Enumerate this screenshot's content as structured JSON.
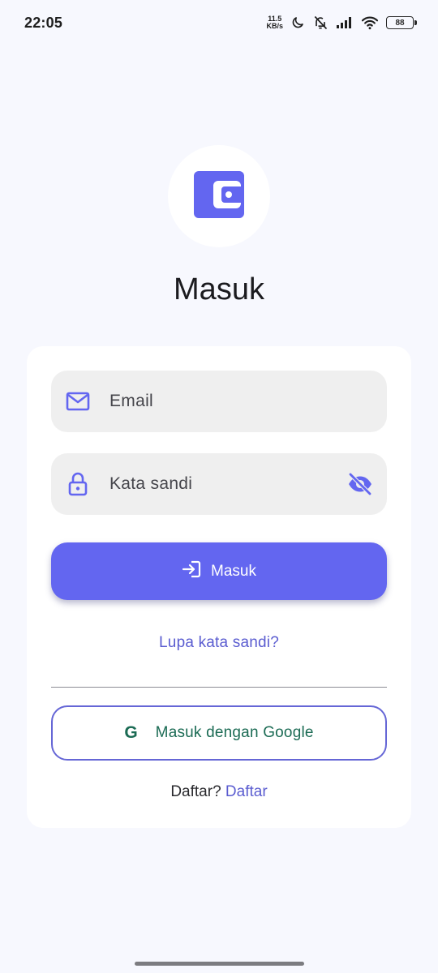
{
  "status_bar": {
    "time": "22:05",
    "net_speed_value": "11.5",
    "net_speed_unit": "KB/s",
    "battery_level": "88",
    "icons": [
      "moon-icon",
      "bell-off-icon",
      "signal-icon",
      "wifi-icon",
      "battery-icon"
    ]
  },
  "logo": {
    "icon": "wallet-icon",
    "accent_color": "#6366f0"
  },
  "page": {
    "title": "Masuk"
  },
  "form": {
    "email": {
      "placeholder": "Email",
      "value": "",
      "icon": "mail-icon"
    },
    "password": {
      "placeholder": "Kata sandi",
      "value": "",
      "icon": "lock-icon",
      "toggle_icon": "eye-off-icon"
    },
    "submit": {
      "label": "Masuk",
      "icon": "login-arrow-icon"
    },
    "forgot_password": "Lupa kata sandi?",
    "google": {
      "icon_letter": "G",
      "label": "Masuk dengan Google"
    },
    "register": {
      "prompt": "Daftar?",
      "link": "Daftar"
    }
  },
  "colors": {
    "primary": "#6366f0",
    "link": "#5a5cd0",
    "google_text": "#1b6b54",
    "background": "#f7f8fe",
    "input_fill": "#efefef"
  }
}
